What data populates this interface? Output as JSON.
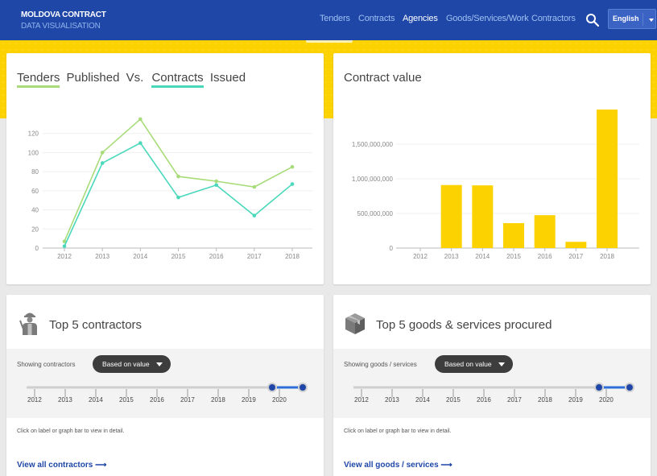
{
  "header": {
    "brand_line1": "MOLDOVA CONTRACT",
    "brand_line2": "DATA VISUALISATION",
    "nav": [
      "Tenders",
      "Contracts",
      "Agencies",
      "Goods/Services/Work",
      "Contractors"
    ],
    "active_nav": "Agencies",
    "language": "English",
    "icons": {
      "search": "search-icon",
      "language_caret": "chevron-down-icon"
    }
  },
  "colors": {
    "header_bg": "#1f47a8",
    "band": "#fcd200",
    "tenders_line": "#a8dc7a",
    "contracts_line": "#4ad8bb",
    "bar": "#fcd200",
    "link": "#1f47a8"
  },
  "tenders_card": {
    "title_parts": [
      "Tenders",
      "Published",
      "Vs.",
      "Contracts",
      "Issued"
    ]
  },
  "value_card": {
    "title": "Contract value"
  },
  "contractors_card": {
    "title": "Top 5 contractors",
    "filter_label": "Showing contractors",
    "dropdown": "Based on value",
    "years": [
      "2012",
      "2013",
      "2014",
      "2015",
      "2016",
      "2017",
      "2018",
      "2019",
      "2020"
    ],
    "hint": "Click on label or graph bar to view in detail.",
    "link": "View all contractors ⟶",
    "icon": "worker-icon"
  },
  "goods_card": {
    "title": "Top 5 goods & services procured",
    "filter_label": "Showing goods / services",
    "dropdown": "Based on value",
    "years": [
      "2012",
      "2013",
      "2014",
      "2015",
      "2016",
      "2017",
      "2018",
      "2019",
      "2020"
    ],
    "hint": "Click on label or graph bar to view in detail.",
    "link": "View all goods / services ⟶",
    "icon": "box-icon"
  },
  "chart_data": [
    {
      "type": "line",
      "title": "Tenders Published Vs. Contracts Issued",
      "x": [
        "2012",
        "2013",
        "2014",
        "2015",
        "2016",
        "2017",
        "2018"
      ],
      "series": [
        {
          "name": "Tenders",
          "values": [
            7,
            100,
            135,
            75,
            70,
            64,
            85
          ]
        },
        {
          "name": "Contracts",
          "values": [
            2,
            89,
            110,
            53,
            66,
            34,
            67
          ]
        }
      ],
      "yticks": [
        "0",
        "20",
        "40",
        "60",
        "80",
        "100",
        "120"
      ],
      "ylim": [
        0,
        140
      ],
      "grid": true
    },
    {
      "type": "bar",
      "title": "Contract value",
      "categories": [
        "2012",
        "2013",
        "2014",
        "2015",
        "2016",
        "2017",
        "2018"
      ],
      "values": [
        0,
        910000000,
        905000000,
        360000000,
        475000000,
        90000000,
        2000000000
      ],
      "yticks": [
        "0",
        "500,000,000",
        "1,000,000,000",
        "1,500,000,000"
      ],
      "ylim": [
        0,
        2000000000
      ],
      "grid": true
    }
  ]
}
